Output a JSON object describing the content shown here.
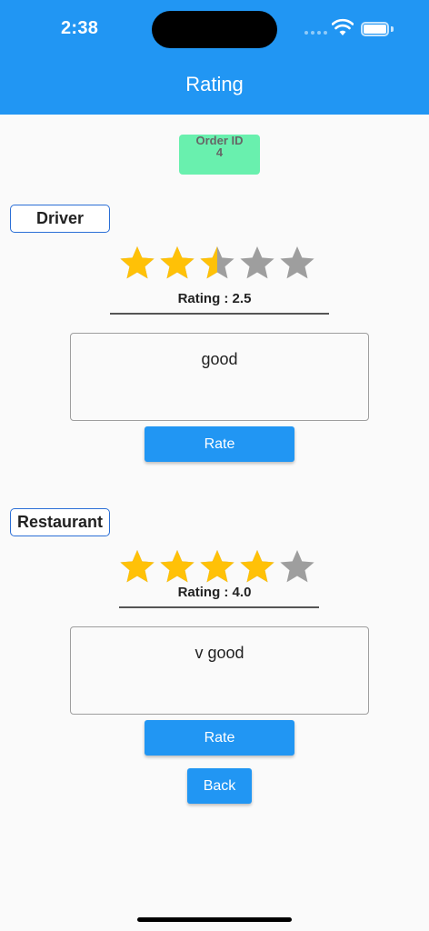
{
  "status_bar": {
    "time": "2:38"
  },
  "app_bar": {
    "title": "Rating"
  },
  "order": {
    "label": "Order ID",
    "id": "4"
  },
  "driver": {
    "label": "Driver",
    "rating_value": 2.5,
    "rating_text": "Rating : 2.5",
    "comment": "good",
    "rate_button": "Rate"
  },
  "restaurant": {
    "label": "Restaurant",
    "rating_value": 4.0,
    "rating_text": "Rating : 4.0",
    "comment": "v good",
    "rate_button": "Rate"
  },
  "back_button": "Back",
  "colors": {
    "app_bar": "#2196f3",
    "star_filled": "#ffc107",
    "star_empty": "#9e9e9e",
    "order_chip": "#69f0ae"
  }
}
